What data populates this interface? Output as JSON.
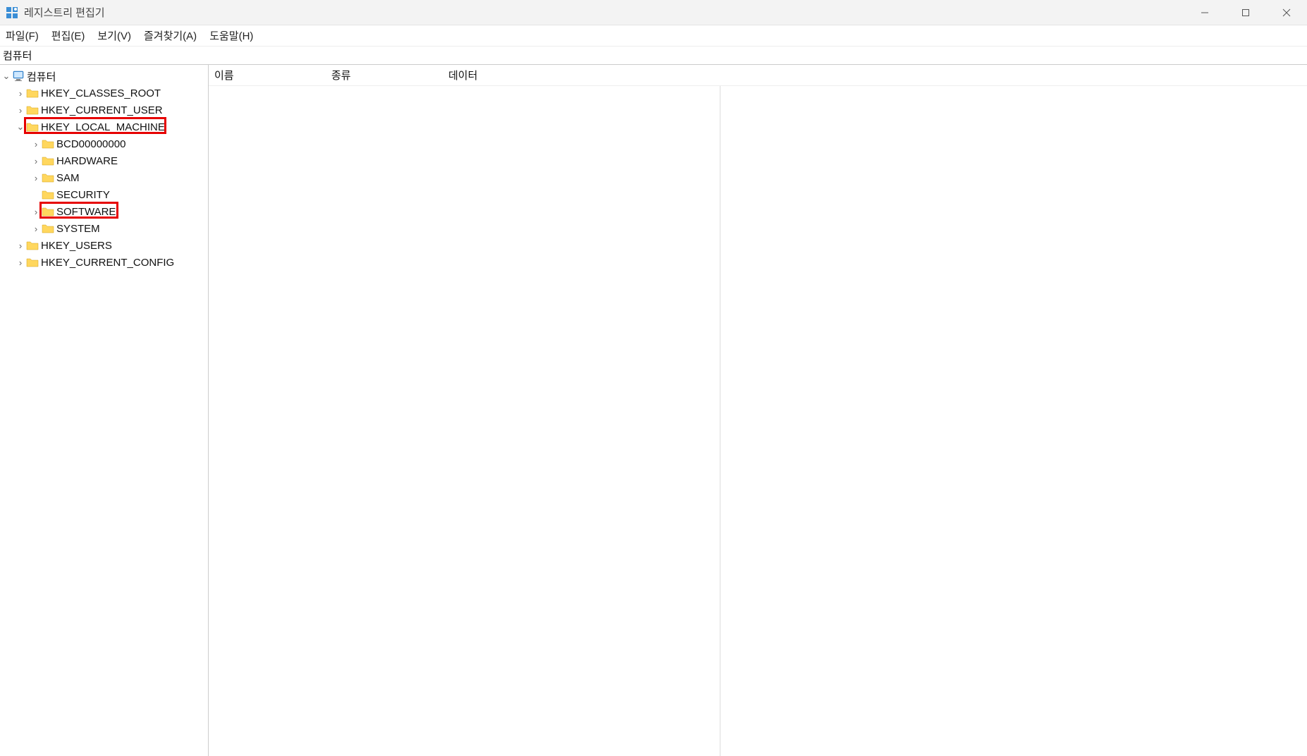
{
  "title": "레지스트리 편집기",
  "menu": {
    "file": "파일(F)",
    "edit": "편집(E)",
    "view": "보기(V)",
    "favorites": "즐겨찾기(A)",
    "help": "도움말(H)"
  },
  "address": "컴퓨터",
  "tree": {
    "root": "컴퓨터",
    "items": [
      {
        "label": "HKEY_CLASSES_ROOT",
        "expander": "›"
      },
      {
        "label": "HKEY_CURRENT_USER",
        "expander": "›"
      },
      {
        "label": "HKEY_LOCAL_MACHINE",
        "expander": "⌄",
        "highlight": true,
        "children": [
          {
            "label": "BCD00000000",
            "expander": "›"
          },
          {
            "label": "HARDWARE",
            "expander": "›"
          },
          {
            "label": "SAM",
            "expander": "›"
          },
          {
            "label": "SECURITY",
            "expander": ""
          },
          {
            "label": "SOFTWARE",
            "expander": "›",
            "highlight": true
          },
          {
            "label": "SYSTEM",
            "expander": "›"
          }
        ]
      },
      {
        "label": "HKEY_USERS",
        "expander": "›"
      },
      {
        "label": "HKEY_CURRENT_CONFIG",
        "expander": "›"
      }
    ]
  },
  "columns": {
    "name": "이름",
    "type": "종류",
    "data": "데이터"
  }
}
